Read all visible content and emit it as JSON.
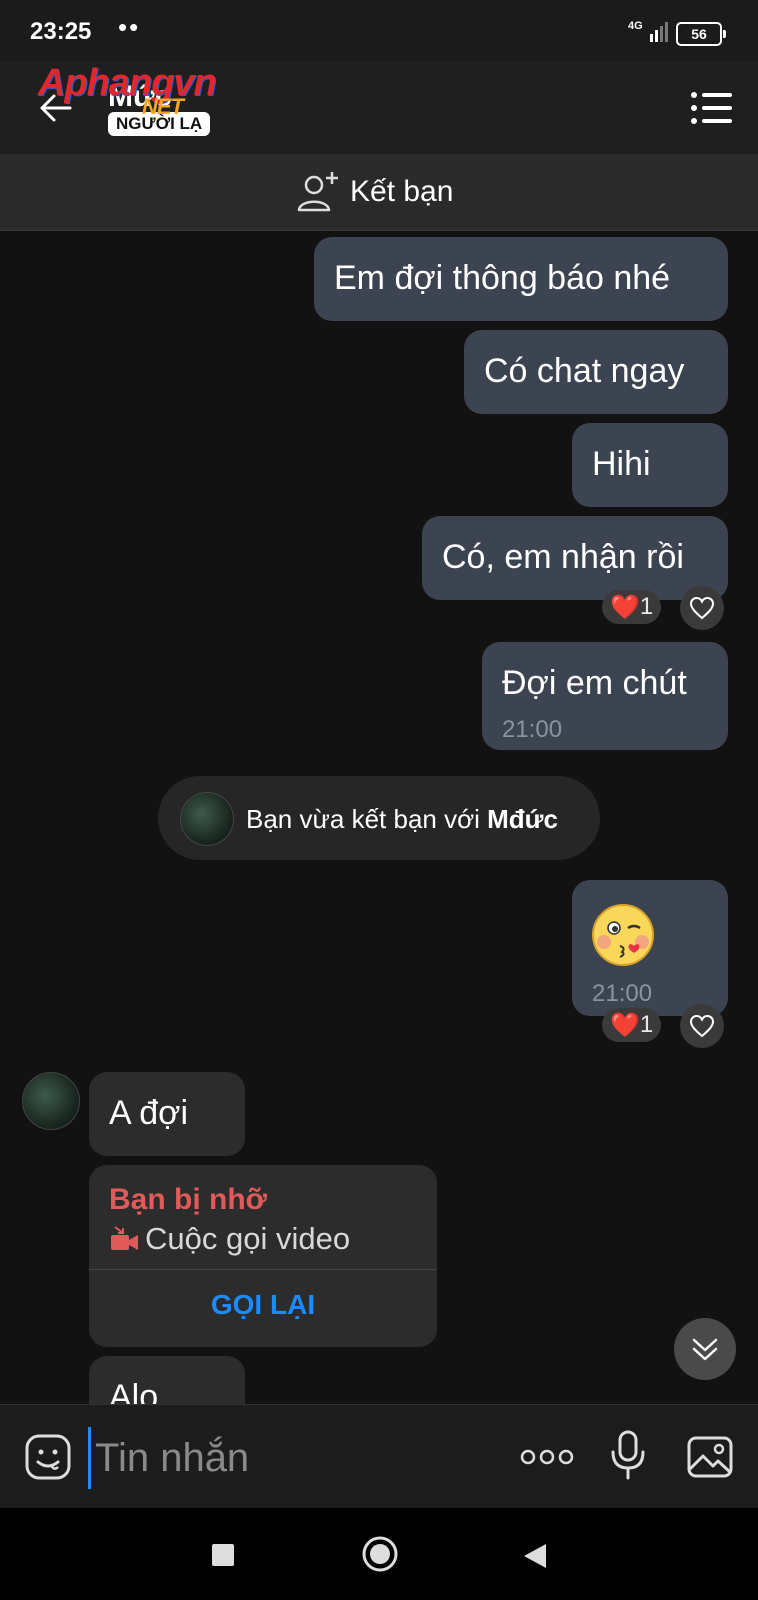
{
  "status_bar": {
    "time": "23:25",
    "dots": "••",
    "network": "4G",
    "battery": "56"
  },
  "header": {
    "contact_name": "Mức",
    "badge": "NGƯỜI LẠ",
    "watermark": "Aphangvn",
    "watermark_suffix": "NET"
  },
  "add_friend": {
    "label": "Kết bạn"
  },
  "messages": {
    "m1": "Em đợi thông báo nhé",
    "m2": "Có chat ngay",
    "m3": "Hihi",
    "m4": "Có, em nhận rồi",
    "m4_reaction": "1",
    "m5": "Đợi em chút",
    "m5_time": "21:00",
    "m6_time": "21:00",
    "m6_reaction": "1",
    "in1": "A đợi",
    "in2": "Alo"
  },
  "system_msg": {
    "prefix": "Bạn vừa kết bạn với ",
    "name": "Mđức"
  },
  "missed_call": {
    "title": "Bạn bị nhỡ",
    "subtitle": "Cuộc gọi video",
    "action": "GỌI LẠI"
  },
  "input": {
    "placeholder": "Tin nhắn"
  },
  "colors": {
    "accent": "#1a8cff",
    "missed": "#e05a5a",
    "bubble_out": "#3c4452",
    "bubble_in": "#2c2c2c"
  }
}
